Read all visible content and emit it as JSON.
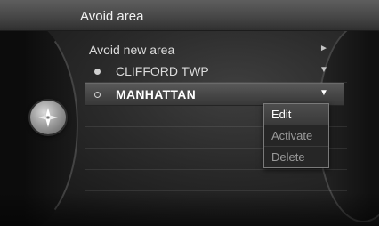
{
  "header": {
    "title": "Avoid area"
  },
  "list": {
    "items": [
      {
        "label": "Avoid new area",
        "arrow": "►",
        "bullet": "none"
      },
      {
        "label": "CLIFFORD TWP",
        "arrow": "▼",
        "bullet": "filled"
      },
      {
        "label": "MANHATTAN",
        "arrow": "▼",
        "bullet": "hollow",
        "selected": true
      }
    ]
  },
  "context_menu": {
    "items": [
      {
        "label": "Edit",
        "active": true
      },
      {
        "label": "Activate",
        "active": false
      },
      {
        "label": "Delete",
        "active": false
      }
    ]
  },
  "icons": {
    "knob": "compass-rose-icon"
  },
  "colors": {
    "background": "#2a2a2a",
    "highlight": "#4a4a4a",
    "text": "#e0e0e0",
    "menu_border": "#7a7a7a"
  }
}
